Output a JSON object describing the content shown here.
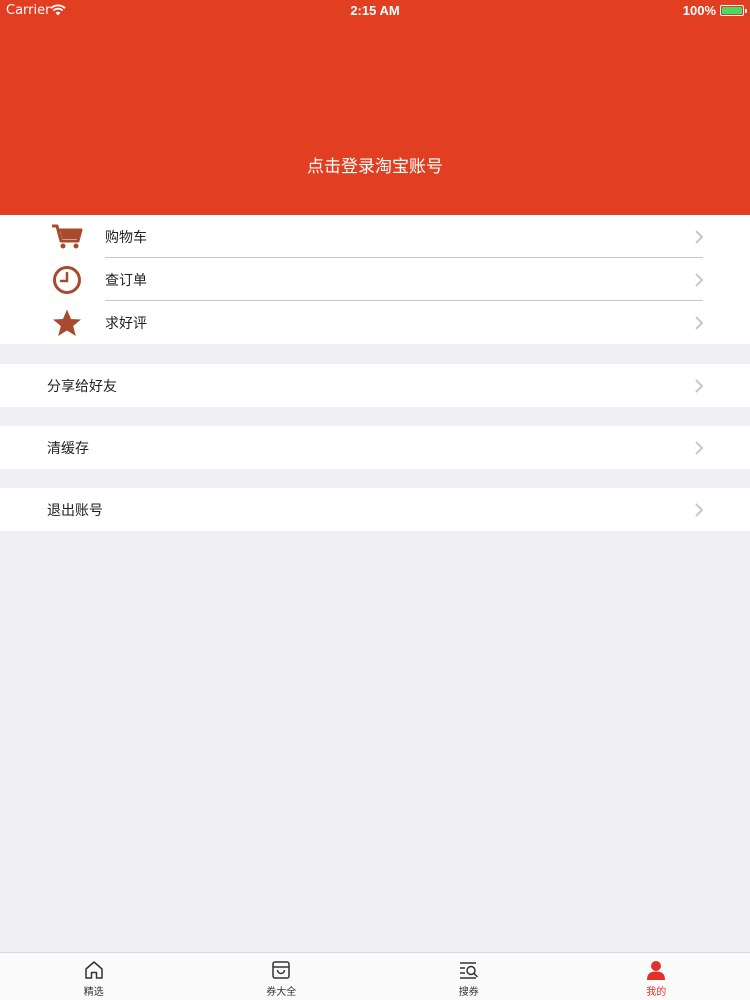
{
  "status_bar": {
    "carrier": "Carrier",
    "time": "2:15 AM",
    "battery": "100%"
  },
  "header": {
    "login_text": "点击登录淘宝账号",
    "background_color": "#e23f22"
  },
  "menu_group_1": [
    {
      "label": "购物车",
      "icon": "cart-icon"
    },
    {
      "label": "查订单",
      "icon": "clock-icon"
    },
    {
      "label": "求好评",
      "icon": "star-icon"
    }
  ],
  "menu_share": {
    "label": "分享给好友"
  },
  "menu_cache": {
    "label": "清缓存"
  },
  "menu_logout": {
    "label": "退出账号"
  },
  "tabbar": {
    "tabs": [
      {
        "label": "精选",
        "icon": "home-icon"
      },
      {
        "label": "券大全",
        "icon": "box-icon"
      },
      {
        "label": "搜券",
        "icon": "search-list-icon"
      },
      {
        "label": "我的",
        "icon": "user-icon",
        "active": true
      }
    ],
    "active_color": "#e0322a"
  },
  "colors": {
    "accent": "#e23f22",
    "icon": "#a84a2e",
    "background": "#efeff4"
  }
}
